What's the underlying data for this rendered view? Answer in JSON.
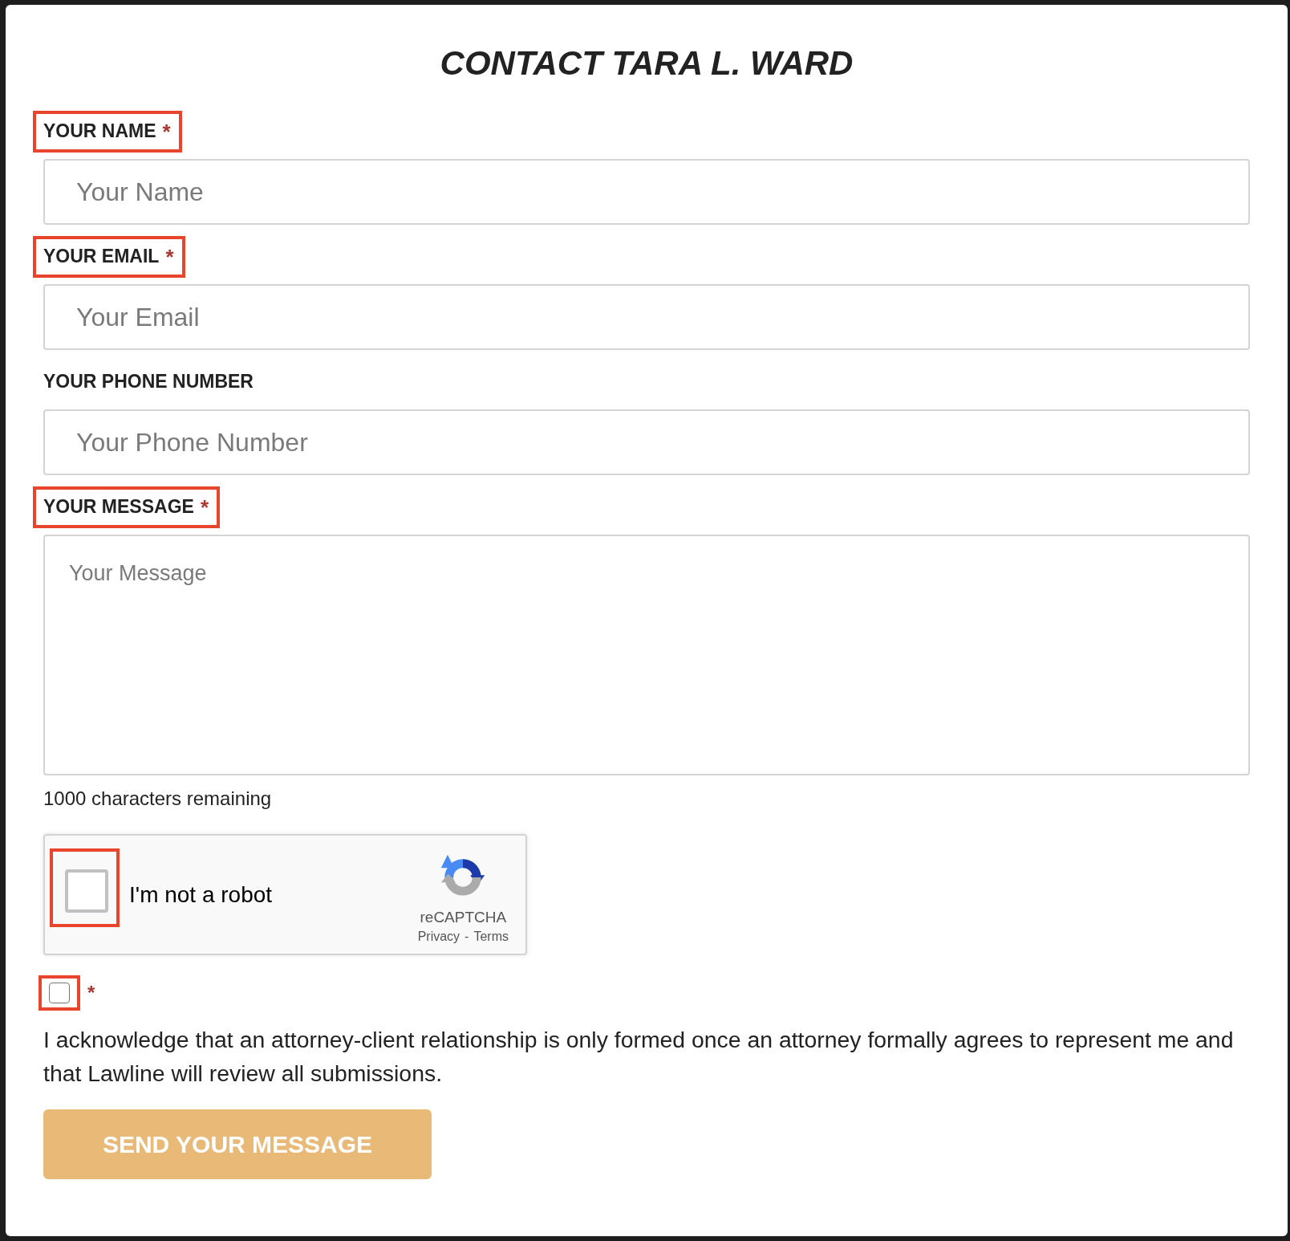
{
  "dialog": {
    "title": "CONTACT TARA L. WARD"
  },
  "fields": [
    {
      "kind": "input",
      "label": "YOUR NAME",
      "required_mark": "*",
      "highlighted": true,
      "placeholder": "Your Name"
    },
    {
      "kind": "input",
      "label": "YOUR EMAIL",
      "required_mark": "*",
      "highlighted": true,
      "placeholder": "Your Email"
    },
    {
      "kind": "input",
      "label": "YOUR PHONE NUMBER",
      "highlighted": false,
      "placeholder": "Your Phone Number"
    },
    {
      "kind": "textarea",
      "label": "YOUR MESSAGE",
      "required_mark": "*",
      "highlighted": true,
      "placeholder": "Your Message",
      "counter": "1000 characters remaining"
    }
  ],
  "captcha": {
    "checked": false,
    "highlighted": true,
    "label": "I'm not a robot",
    "brand": "reCAPTCHA",
    "links": [
      "Privacy",
      "Terms"
    ],
    "separator": "-"
  },
  "acknowledgement": {
    "checked": false,
    "highlighted": true,
    "required_mark": "*",
    "text": "I acknowledge that an attorney-client relationship is only formed once an attorney formally agrees to represent me and that Lawline will review all submissions."
  },
  "submit": {
    "label": "SEND YOUR MESSAGE",
    "disabled": true
  }
}
